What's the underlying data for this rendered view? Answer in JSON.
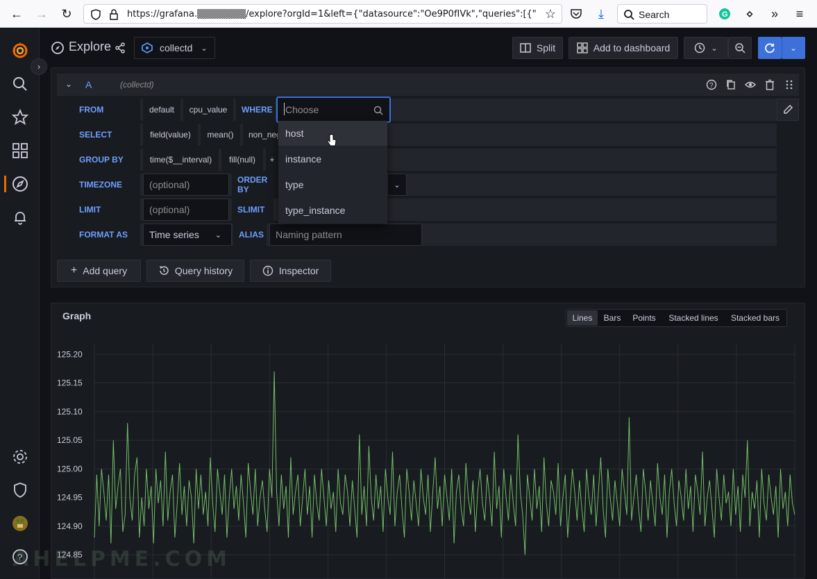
{
  "browser": {
    "url": "https://grafana.▒▒▒▒▒▒▒/explore?orgId=1&left={\"datasource\":\"Oe9P0fIVk\",\"queries\":[{\"ref",
    "search_label": "Search"
  },
  "header": {
    "title": "Explore",
    "datasource": "collectd",
    "split_label": "Split",
    "add_to_dashboard_label": "Add to dashboard"
  },
  "query": {
    "ref_id": "A",
    "datasource_hint": "(collectd)",
    "from_label": "FROM",
    "from_policy": "default",
    "from_measurement": "cpu_value",
    "where_label": "WHERE",
    "where_placeholder": "Choose",
    "select_label": "SELECT",
    "select_field": "field(value)",
    "select_agg": "mean()",
    "select_extra": "non_neg",
    "group_by_label": "GROUP BY",
    "group_time": "time($__interval)",
    "group_fill": "fill(null)",
    "group_add": "+",
    "timezone_label": "TIMEZONE",
    "timezone_placeholder": "(optional)",
    "order_by_label": "ORDER BY",
    "limit_label": "LIMIT",
    "limit_placeholder": "(optional)",
    "slimit_label": "SLIMIT",
    "format_label": "FORMAT AS",
    "format_value": "Time series",
    "alias_label": "ALIAS",
    "alias_placeholder": "Naming pattern"
  },
  "dropdown": {
    "items": [
      "host",
      "instance",
      "type",
      "type_instance"
    ]
  },
  "actions": {
    "add_query": "Add query",
    "query_history": "Query history",
    "inspector": "Inspector"
  },
  "graph": {
    "title": "Graph",
    "modes": [
      "Lines",
      "Bars",
      "Points",
      "Stacked lines",
      "Stacked bars"
    ],
    "active_mode": "Lines",
    "line_color": "#73bf69"
  },
  "watermark": "AHELPME.COM",
  "chart_data": {
    "type": "line",
    "title": "",
    "xlabel": "",
    "ylabel": "",
    "y_ticks": [
      "125.20",
      "125.15",
      "125.10",
      "125.05",
      "125.00",
      "124.95",
      "124.90",
      "124.85"
    ],
    "ylim": [
      124.84,
      125.21
    ],
    "grid": true,
    "series": [
      {
        "color": "#73bf69",
        "values": [
          124.88,
          124.99,
          124.9,
          125.0,
          124.96,
          124.91,
          124.99,
          124.87,
          125.05,
          124.93,
          124.97,
          125.0,
          124.89,
          124.92,
          125.08,
          124.95,
          124.91,
          124.99,
          125.02,
          124.88,
          124.95,
          124.9,
          125.0,
          124.93,
          124.97,
          124.87,
          125.0,
          124.94,
          124.98,
          124.9,
          125.03,
          124.91,
          124.96,
          124.99,
          124.88,
          124.94,
          125.01,
          124.92,
          124.97,
          124.9,
          124.98,
          124.95,
          124.87,
          125.0,
          124.93,
          124.99,
          124.92,
          124.96,
          124.9,
          125.02,
          124.94,
          124.89,
          125.0,
          124.96,
          124.92,
          124.99,
          124.88,
          124.95,
          125.0,
          124.93,
          124.97,
          124.91,
          124.99,
          124.94,
          124.88,
          125.01,
          124.96,
          124.92,
          125.0,
          124.9,
          124.95,
          124.98,
          124.93,
          124.89,
          125.0,
          124.95,
          125.17,
          124.96,
          124.9,
          124.99,
          124.93,
          124.97,
          124.88,
          125.02,
          124.92,
          124.96,
          124.99,
          124.9,
          124.95,
          125.0,
          124.92,
          124.97,
          124.88,
          124.99,
          124.94,
          124.91,
          125.0,
          124.95,
          124.9,
          124.98,
          124.93,
          124.96,
          124.89,
          125.0,
          124.94,
          124.92,
          124.99,
          124.96,
          124.9,
          124.98,
          124.93,
          124.88,
          125.06,
          124.92,
          124.97,
          124.9,
          125.04,
          124.95,
          124.91,
          124.99,
          124.93,
          124.97,
          124.89,
          125.0,
          124.95,
          124.92,
          125.03,
          124.9,
          124.96,
          124.99,
          124.93,
          124.88,
          125.0,
          124.96,
          124.91,
          124.98,
          124.94,
          124.9,
          125.0,
          124.95,
          124.92,
          124.99,
          124.89,
          124.96,
          125.02,
          124.93,
          124.97,
          124.9,
          124.99,
          124.95,
          124.91,
          125.0,
          124.87,
          124.96,
          124.99,
          124.93,
          124.9,
          125.01,
          124.95,
          124.92,
          124.98,
          124.89,
          124.96,
          125.0,
          124.94,
          124.91,
          124.99,
          124.95,
          124.9,
          125.03,
          124.93,
          124.97,
          124.88,
          125.0,
          124.95,
          124.91,
          124.99,
          124.94,
          124.9,
          125.06,
          124.96,
          124.92,
          124.85,
          124.99,
          124.95,
          124.91,
          125.0,
          124.93,
          124.97,
          124.89,
          125.02,
          124.94,
          124.9,
          124.98,
          124.96,
          124.92,
          125.01,
          124.9,
          124.95,
          124.99,
          124.88,
          124.94,
          125.0,
          124.96,
          124.91,
          124.98,
          124.93,
          124.89,
          125.0,
          124.95,
          124.92,
          124.99,
          124.9,
          124.96,
          125.02,
          124.93,
          124.88,
          125.0,
          124.95,
          124.91,
          124.98,
          124.94,
          124.9,
          125.0,
          124.96,
          124.92,
          125.09,
          124.91,
          124.95,
          124.99,
          124.93,
          124.89,
          125.0,
          124.96,
          124.91,
          124.98,
          124.94,
          124.9,
          125.01,
          124.95,
          124.92,
          124.99,
          124.88,
          124.96,
          125.0,
          124.94,
          124.9,
          124.98,
          124.95,
          124.91,
          125.0,
          124.93,
          124.97,
          124.89,
          124.99,
          124.96,
          124.92,
          125.03,
          124.9,
          124.95,
          124.98,
          124.93,
          124.88,
          125.0,
          124.95,
          124.91,
          124.99,
          124.94,
          124.96,
          124.9,
          125.0,
          124.92,
          124.97,
          124.89,
          124.99,
          124.95,
          125.05,
          124.9,
          124.96,
          124.93,
          124.98,
          124.88,
          125.0,
          124.94,
          124.91,
          124.99,
          124.95,
          124.92,
          124.97,
          124.88,
          125.0,
          124.93,
          124.96,
          124.9,
          124.99,
          124.94,
          124.92
        ]
      }
    ]
  }
}
